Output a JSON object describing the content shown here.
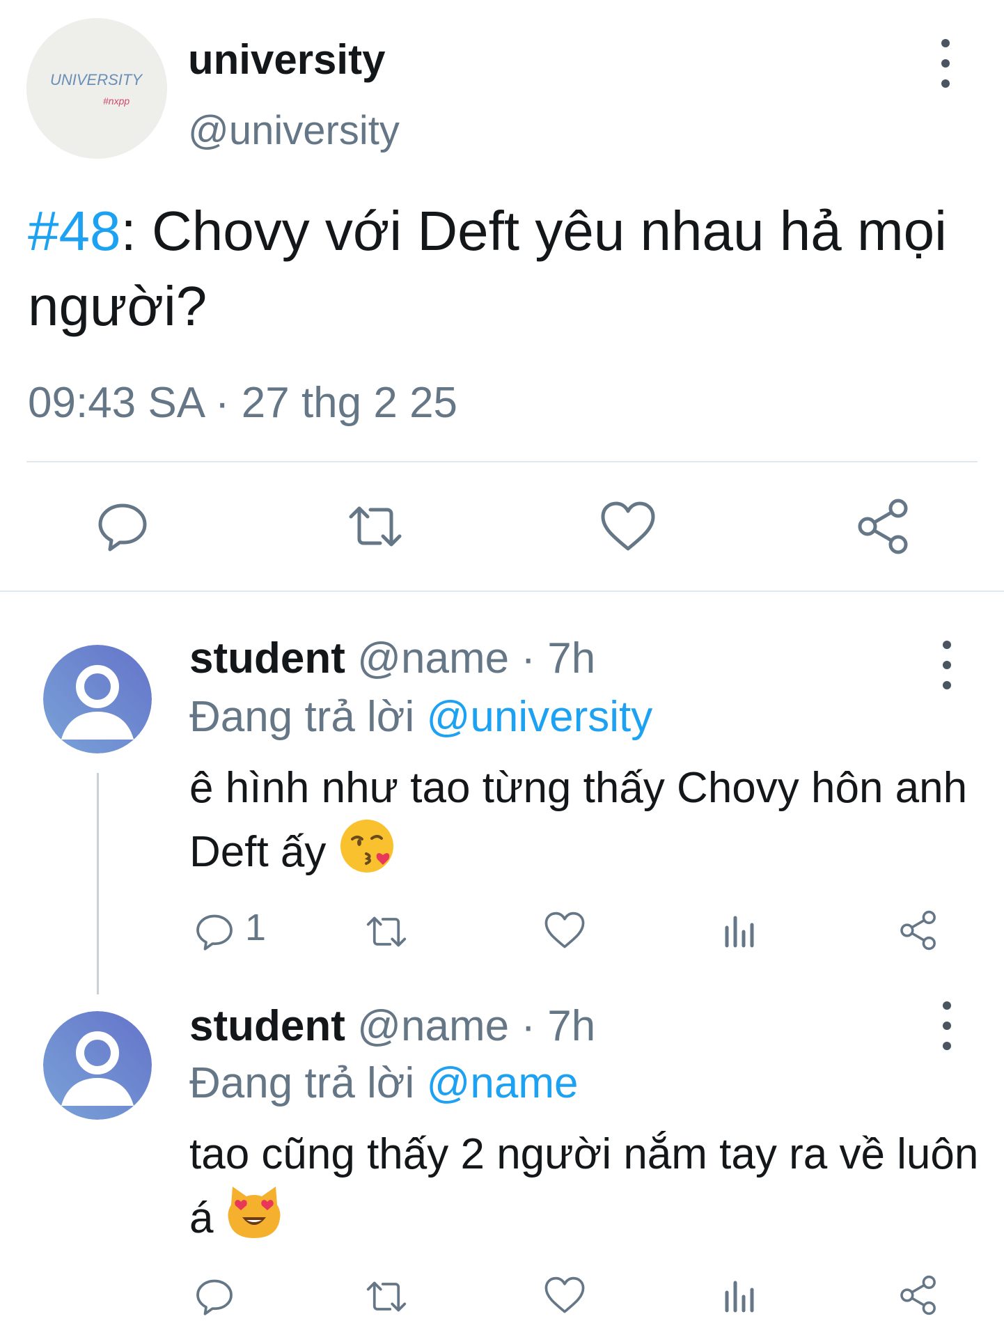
{
  "tweet": {
    "avatar_text": "UNIVERSITY",
    "avatar_subtext": "#nxpp",
    "display_name": "university",
    "handle": "@university",
    "hashtag": "#48",
    "text_body": ": Chovy với Deft yêu nhau hả mọi người?",
    "timestamp": "09:43 SA · 27 thg 2 25",
    "actions": [
      "reply-icon",
      "retweet-icon",
      "like-icon",
      "share-icon"
    ]
  },
  "replies": [
    {
      "name": "student",
      "handle": "@name",
      "time": "· 7h",
      "replying_label": "Đang trả lời",
      "replying_to": "@university",
      "text": "ê hình như tao từng thấy Chovy hôn anh Deft ấy",
      "emoji": "kissing-face-emoji",
      "reply_count": "1"
    },
    {
      "name": "student",
      "handle": "@name",
      "time": "· 7h",
      "replying_label": "Đang trả lời",
      "replying_to": "@name",
      "text": "tao cũng thấy 2 người nắm tay ra về luôn á",
      "emoji": "heart-eyes-cat-emoji",
      "reply_count": ""
    }
  ],
  "colors": {
    "accent": "#1da1f2",
    "muted": "#657786",
    "text": "#14171a",
    "divider": "#e1e8ed"
  }
}
